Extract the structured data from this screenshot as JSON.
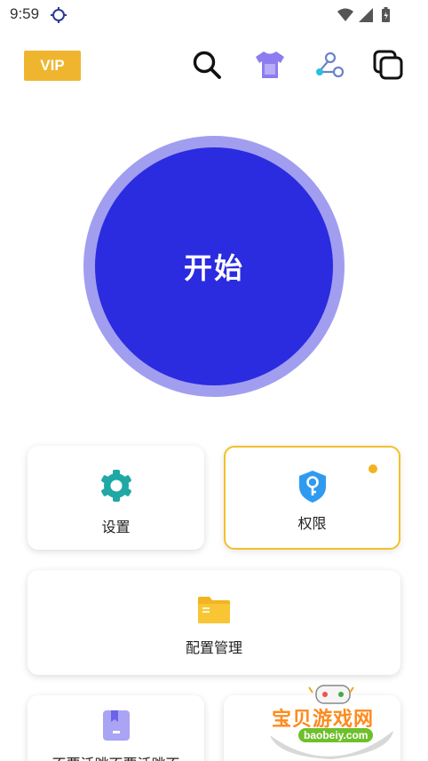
{
  "status_bar": {
    "time": "9:59"
  },
  "top_bar": {
    "vip_label": "VIP",
    "icons": [
      "search-icon",
      "tshirt-icon",
      "share-icon",
      "copy-icon"
    ]
  },
  "start_button": {
    "label": "开始"
  },
  "cards": {
    "settings": {
      "label": "设置",
      "icon": "gear-icon"
    },
    "permissions": {
      "label": "权限",
      "icon": "shield-key-icon",
      "has_dot": true
    },
    "config_management": {
      "label": "配置管理",
      "icon": "folder-icon"
    },
    "bottom_left": {
      "label": "不要活跳不要活跳不",
      "icon": "bookmark-icon"
    }
  },
  "watermark": {
    "title": "宝贝游戏网",
    "url": "baobeiy.com"
  },
  "colors": {
    "vip": "#f0b52f",
    "start_ring": "#a19ef0",
    "start_fill": "#2b2be0",
    "gear": "#1fa8a5",
    "shield": "#2f9bf0",
    "folder": "#f4b321",
    "active_border": "#f3c02a"
  }
}
